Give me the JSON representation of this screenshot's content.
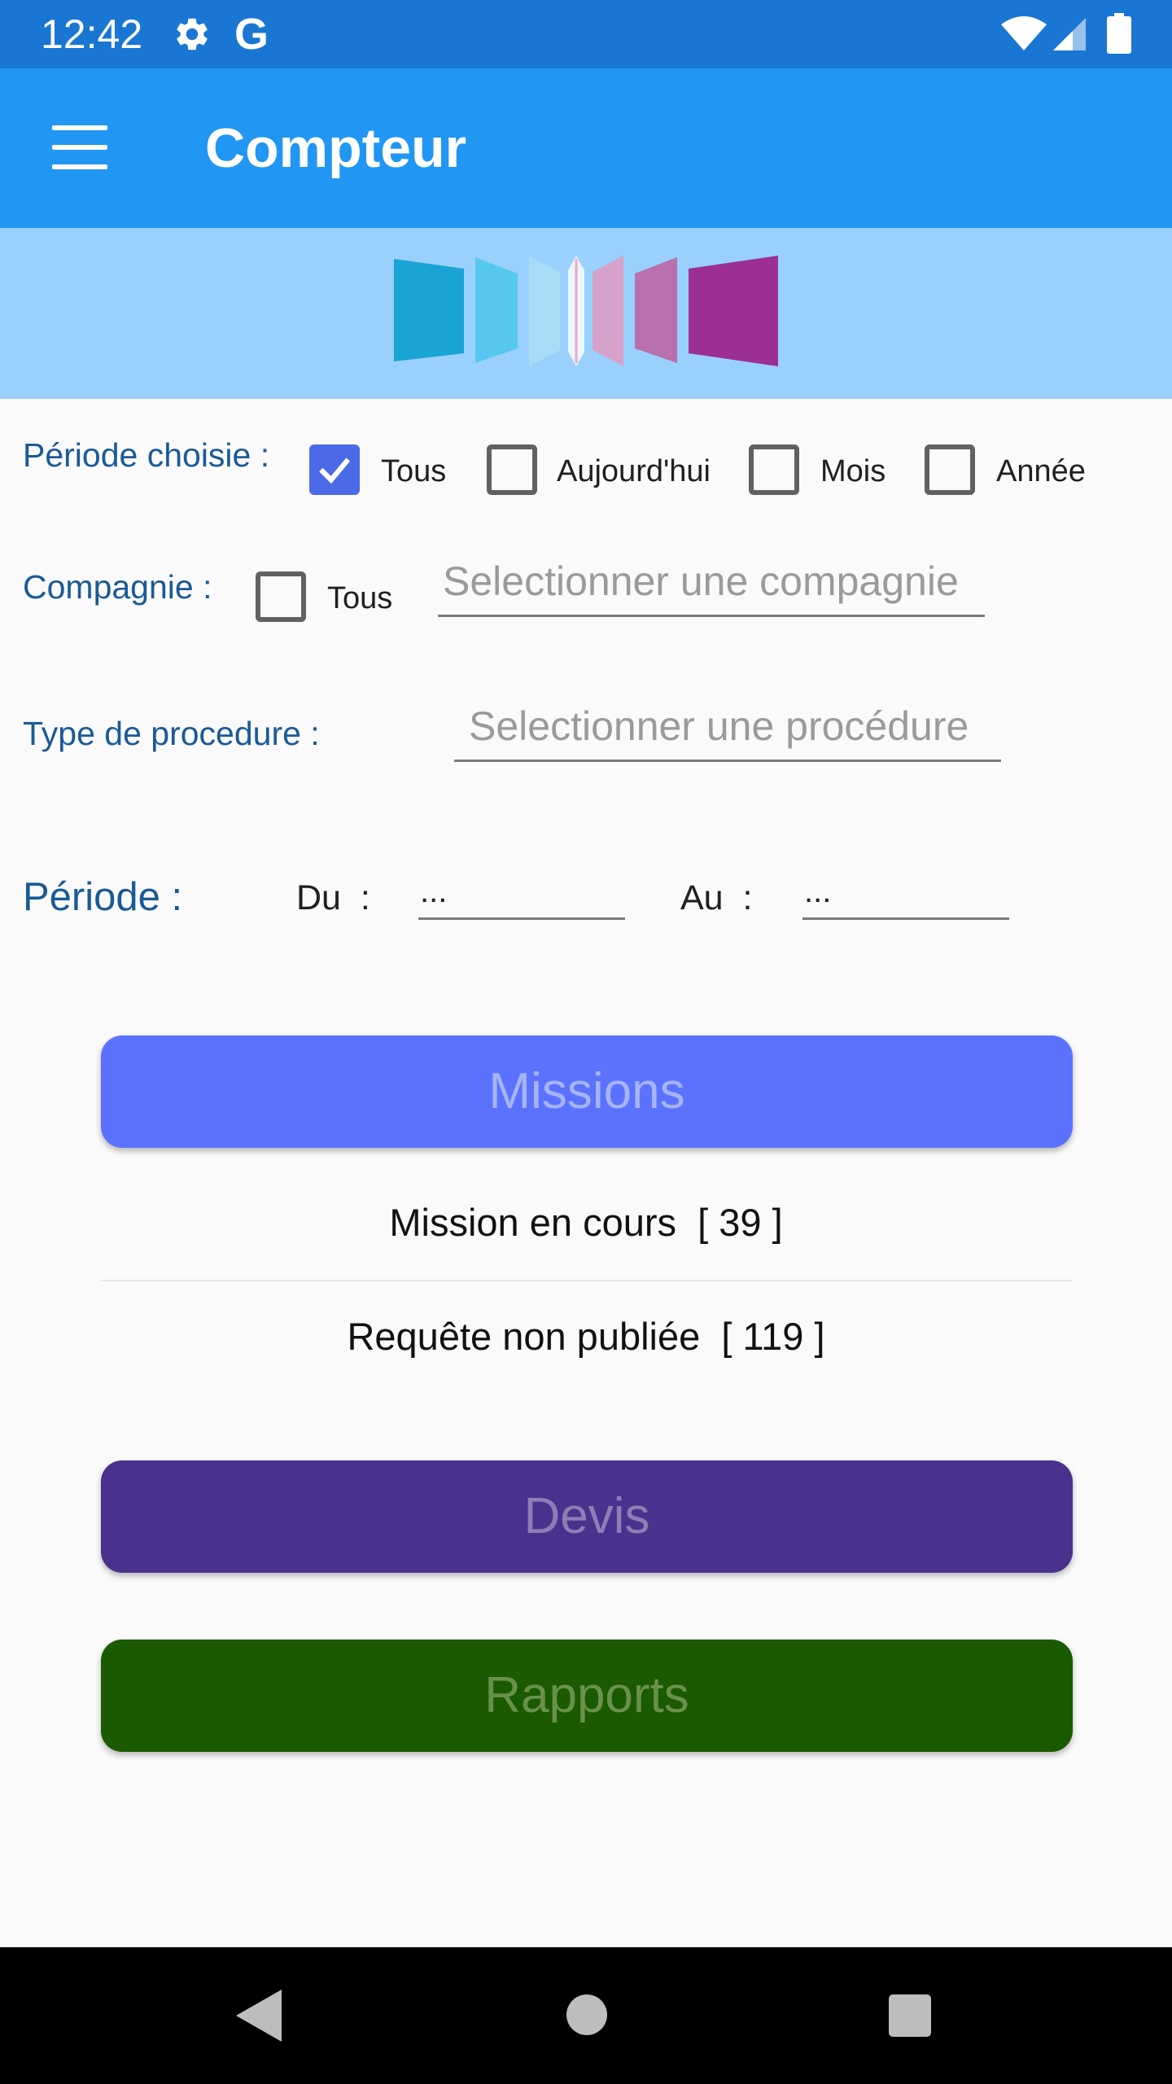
{
  "status_bar": {
    "time": "12:42",
    "g_label": "G",
    "icons": [
      "gear-icon",
      "google-icon",
      "wifi-icon",
      "signal-icon",
      "battery-icon"
    ]
  },
  "app_bar": {
    "title": "Compteur",
    "menu_icon": "menu-icon"
  },
  "colors": {
    "status_bar": "#1976d2",
    "app_bar": "#2196f3",
    "banner": "#99d1fc",
    "label": "#1a5a96",
    "checkbox_checked": "#4b6ae8",
    "missions_button": "#5b72ff",
    "devis_button": "#4b318e",
    "rapports_button": "#1a5a00"
  },
  "filters": {
    "periode_choisie": {
      "label": "Période choisie :",
      "options": [
        {
          "label": "Tous",
          "checked": true
        },
        {
          "label": "Aujourd'hui",
          "checked": false
        },
        {
          "label": "Mois",
          "checked": false
        },
        {
          "label": "Année",
          "checked": false
        }
      ]
    },
    "compagnie": {
      "label": "Compagnie :",
      "tous_label": "Tous",
      "tous_checked": false,
      "placeholder": "Selectionner une compagnie"
    },
    "type_procedure": {
      "label": "Type de procedure :",
      "placeholder": "Selectionner une procédure"
    },
    "periode": {
      "label": "Période :",
      "du_label": "Du  :",
      "du_value": "...",
      "au_label": "Au  :",
      "au_value": "..."
    }
  },
  "buttons": {
    "missions": "Missions",
    "devis": "Devis",
    "rapports": "Rapports"
  },
  "stats": {
    "missions_en_cours": "Mission en cours  [ 39 ]",
    "requetes_non_publiees": "Requête non publiée  [ 119 ]"
  },
  "nav_bar": {
    "icons": [
      "back-icon",
      "home-icon",
      "recent-apps-icon"
    ]
  }
}
